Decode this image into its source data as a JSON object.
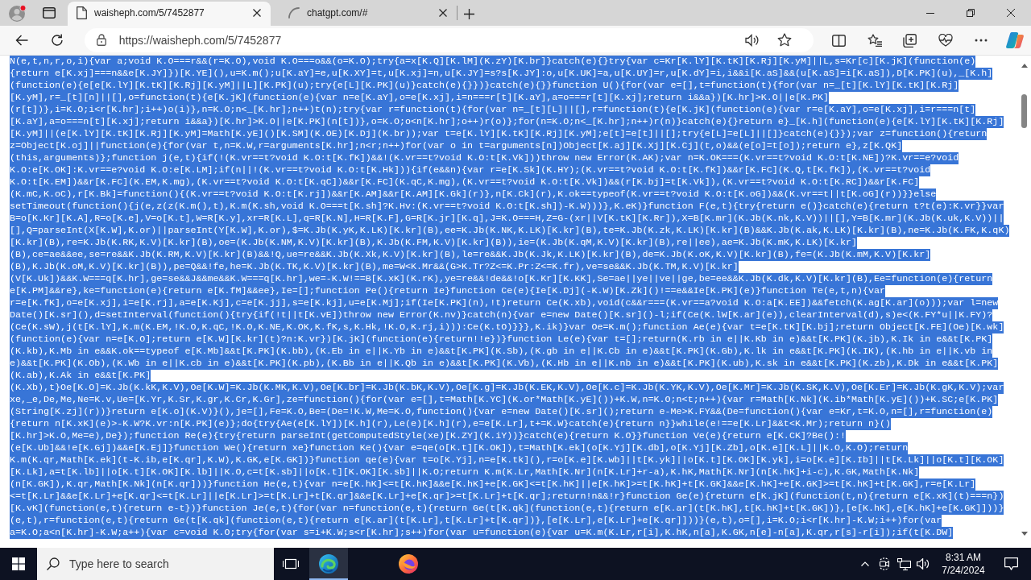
{
  "browser": {
    "tabs": [
      {
        "title": "waisheph.com/5/7452877",
        "selected": true,
        "kind": "page"
      },
      {
        "title": "chatgpt.com/#",
        "selected": false,
        "kind": "loading"
      }
    ],
    "address": {
      "value": "https://waisheph.com/5/7452877"
    }
  },
  "page": {
    "lines": [
      {
        "text": "N(e,t,n,r,o,i){var a;void K.O===r&&(r=K.O),void K.O===o&&(o=K.O);try{a=x[K.Q][K.lM](K.zY)[K.br]}catch(e){}try{var c=Kr[K.lY][K.tK][K.Rj][K.yM]||L,s=Kr[c][K.jK](function(e)",
        "selected": true
      },
      {
        "text": "{return e[K.xj]===n&&e[K.JY]})[K.YE](),u=K.m();u[K.aY]=e,u[K.XY]=t,u[K.xj]=n,u[K.JY]=s?s[K.JY]:o,u[K.UK]=a,u[K.UY]=r,u[K.dY]=i,i&&i[K.aS]&&(u[K.aS]=i[K.aS]),D[K.PK](u),_[K.h]",
        "selected": true
      },
      {
        "text": "(function(e){e[e[K.lY][K.tK][K.Rj][K.yM]||L][K.PK](u);try{e[L][K.PK](u)}catch(e){}})}catch(e){}}function U(){for(var e=[],t=function(t){for(var n=_[t][K.lY][K.tK][K.Rj]",
        "selected": true
      },
      {
        "text": "[K.yM],r=_[t][n]||[],o=function(t){e[K.jK](function(e){var n=e[K.aY],o=e[K.xj],i=n===r[t][K.aY],a=o===r[t][K.xj];return i&&a})[K.hr]>K.O||e[K.PK]",
        "selected": true
      },
      {
        "text": "(r[t])},i=K.O;i<r[K.hr];i++)o(i)},n=K.O;n<_[K.hr];n++)t(n);try{var r=function(t){for(var n=_[t][L]||[],r=function(t){e[K.jK](function(e){var r=e[K.aY],o=e[K.xj],i=r===n[t]",
        "selected": true
      },
      {
        "text": "[K.aY],a=o===n[t][K.xj];return i&&a})[K.hr]>K.O||e[K.PK](n[t])},o=K.O;o<n[K.hr];o++)r(o)};for(n=K.O;n<_[K.hr];n++)r(n)}catch(e){}return e}_[K.h](function(e){e[K.lY][K.tK][K.Rj]",
        "selected": true
      },
      {
        "text": "[K.yM]||(e[K.lY][K.tK][K.Rj][K.yM]=Math[K.yE]()[K.SM](K.OE)[K.Dj](K.br));var t=e[K.lY][K.tK][K.Rj][K.yM];e[t]=e[t]||[];try{e[L]=e[L]||[]}catch(e){}});var z=function(){return",
        "selected": true
      },
      {
        "text": "z=Object[K.oj]||function(e){for(var t,n=K.W,r=arguments[K.hr];n<r;n++)for(var o in t=arguments[n])Object[K.aj][K.Xj][K.Cj](t,o)&&(e[o]=t[o]);return e},z[K.QK]",
        "selected": true
      },
      {
        "text": "(this,arguments)};function j(e,t){if(!(K.vr==t?void K.O:t[K.fK])&&!(K.vr==t?void K.O:t[K.Vk]))throw new Error(K.AK);var n=K.OK===(K.vr==t?void K.O:t[K.NE])?K.vr==e?void",
        "selected": true
      },
      {
        "text": "K.O:e[K.OK]:K.vr==e?void K.O:e[K.LM];if(n||!(K.vr==t?void K.O:t[K.Hk])){if(e&&n){var r=e[K.Sk](K.HY);(K.vr==t?void K.O:t[K.fK])&&r[K.FC](K.Q,t[K.fK]),(K.vr==t?void",
        "selected": true
      },
      {
        "text": "K.O:t[K.EM])&&r[K.FC](K.EM,K.mg),(K.vr==t?void K.O:t[K.qC])&&r[K.FC](K.qC,K.mg),(K.vr==t?void K.O:t[K.Vk])&&(r[K.bj]=t[K.Vk]),(K.vr==t?void K.O:t[K.RC])&&r[K.FC]",
        "selected": true
      },
      {
        "text": "(K.mC,K.oC),r[K.Bk]=function(){(K.vr==t?void K.O:t[K.rj])&&r[K.AM]&&r[K.AM][K.Gk](r)},n[K.Ck](r),K.ok==typeof(K.vr==t?void K.O:t[K.oG])&&(K.vr==t||t[K.oG](r))}}else",
        "selected": true
      },
      {
        "text": "setTimeout(function(){j(e,z(z(K.m(),t),K.m(K.sh,void K.O===t[K.sh]?K.Hv:(K.vr==t?void K.O:t[K.sh])-K.W)))},K.eK)}function F(e,t){try{return e()}catch(e){return t?t(e):K.vr}}var",
        "selected": true
      },
      {
        "text": "B=o[K.Kr][K.A],R=o[K.e],V=o[K.t],W=R[K.y],xr=R[K.L],q=R[K.N],H=R[K.F],G=R[K.jr][K.q],J=K.O===H,Z=G-(xr||V[K.tK][K.Rr]),X=B[K.mr](K.Jb(K.nk,K.V))||[],Y=B[K.mr](K.Jb(K.uk,K.V))||",
        "selected": true
      },
      {
        "text": "[],Q=parseInt(X[K.W],K.or)||parseInt(Y[K.W],K.or),$=K.Jb(K.yK,K.LK)[K.kr](B),ee=K.Jb(K.NK,K.LK)[K.kr](B),te=K.Jb(K.zk,K.LK)[K.kr](B)&&K.Jb(K.ak,K.LK)[K.kr](B),ne=K.Jb(K.FK,K.qK)",
        "selected": true
      },
      {
        "text": "[K.kr](B),re=K.Jb(K.RK,K.V)[K.kr](B),oe=(K.Jb(K.NM,K.V)[K.kr](B),K.Jb(K.FM,K.V)[K.kr](B)),ie=(K.Jb(K.qM,K.V)[K.kr](B),re||ee),ae=K.Jb(K.mK,K.LK)[K.kr]",
        "selected": true
      },
      {
        "text": "(B),ce=ae&&ee,se=re&&K.Jb(K.RM,K.V)[K.kr](B)&&!Q,ue=re&&K.Jb(K.Xk,K.V)[K.kr](B),le=re&&K.Jb(K.Jk,K.LK)[K.kr](B),de=K.Jb(K.oK,K.V)[K.kr](B),fe=(K.Jb(K.mM,K.V)[K.kr]",
        "selected": true
      },
      {
        "text": "(B),K.Jb(K.oM,K.V)[K.kr](B)),pe=Q&&!fe,he=K.Jb(K.TK,K.V)[K.kr](B),me=W<K.Mr&&(G>K.Tr?Z<=K.Pr:Z<=K.fr),ve=se&&K.Jb(K.TM,K.V)[K.kr]",
        "selected": true
      },
      {
        "text": "(V[K.Uk])&&K.W===q[K.hr],ge=se&&J&&me&&K.W===q[K.hr],we=-K.W!==B[K.xK](K.rK),ye=re&&!de&&!o[K.Kr][K.KK],Se=ae||ye||ve||ge,be=ee&&K.Jb(K.dk,K.V)[K.kr](B),Ee=function(e){return",
        "selected": true
      },
      {
        "text": "e[K.PM]&&re},ke=function(e){return e[K.fM]&&ee},Ie=[];function Pe(){return Ie}function Ce(e){Ie[K.Dj](-K.W)[K.Zk]()!==e&&Ie[K.PK](e)}function Te(e,t,n){var",
        "selected": true
      },
      {
        "text": "r=e[K.fK],o=e[K.xj],i=e[K.rj],a=e[K.Kj],c=e[K.jj],s=e[K.kj],u=e[K.Mj];if(Ie[K.PK](n),!t)return Ce(K.xb),void(c&&r===(K.vr==a?void K.O:a[K.EE])&&fetch(K.ag[K.ar](o)));var l=new",
        "selected": true
      },
      {
        "text": "Date()[K.sr](),d=setInterval(function(){try{if(!t||t[K.vE])throw new Error(K.nv)}catch(n){var e=new Date()[K.sr]()-l;if(Ce(K.lW[K.ar](e)),clearInterval(d),s)e<(K.FY*u||K.FY)?",
        "selected": true
      },
      {
        "text": "(Ce(K.sW),j(t[K.lY],K.m(K.EM,!K.O,K.qC,!K.O,K.NE,K.OK,K.fK,s,K.Hk,!K.O,K.rj,i))):Ce(K.tO)}}},K.ik)}var Oe=K.m();function Ae(e){var t=e[K.tK][K.bj];return Object[K.FE](Oe)[K.wk]",
        "selected": true
      },
      {
        "text": "(function(e){var n=e[K.O];return e[K.W][K.kr](t)?n:K.vr})[K.jK](function(e){return!!e})}function Le(e){var t=[];return(K.rb in e||K.Kb in e)&&t[K.PK](K.jb),K.Ik in e&&t[K.PK]",
        "selected": true
      },
      {
        "text": "(K.kb),K.Mb in e&&K.ok==typeof e[K.Mb]&&t[K.PK](K.bb),(K.Eb in e||K.Yb in e)&&t[K.PK](K.Sb),(K.gb in e||K.Cb in e)&&t[K.PK](K.Gb),K.lk in e&&t[K.PK](K.IK),(K.hb in e||K.vb in",
        "selected": true
      },
      {
        "text": "e)&&t[K.PK](K.Ob),(K.Wb in e||K.cb in e)&&t[K.PK](K.pb),(K.Bb in e||K.Qb in e)&&t[K.PK](K.Vb),(K.Hb in e||K.nb in e)&&t[K.PK](K.ub),K.sk in e&&t[K.PK](K.zb),K.Dk in e&&t[K.PK]",
        "selected": true
      },
      {
        "text": "(K.ab),K.Ak in e&&t[K.PK]",
        "selected": true
      },
      {
        "text": "(K.Xb),t}Oe[K.O]=K.Jb(K.kK,K.V),Oe[K.W]=K.Jb(K.MK,K.V),Oe[K.br]=K.Jb(K.bK,K.V),Oe[K.g]=K.Jb(K.EK,K.V),Oe[K.c]=K.Jb(K.YK,K.V),Oe[K.Mr]=K.Jb(K.SK,K.V),Oe[K.Er]=K.Jb(K.gK,K.V);var",
        "selected": true
      },
      {
        "text": "xe,_e,De,Me,Ne=K.v,Ue=[K.Yr,K.Sr,K.gr,K.Cr,K.Gr],ze=function(){for(var e=[],t=Math[K.YC](K.or*Math[K.yE]())+K.W,n=K.O;n<t;n++){var r=Math[K.Nk](K.ib*Math[K.yE]())+K.SC;e[K.PK]",
        "selected": true
      },
      {
        "text": "(String[K.zj](r))}return e[K.o](K.V)}(),je=[],Fe=K.O,Be=(De=!K.W,Me=K.O,function(){var e=new Date()[K.sr]();return e-Me>K.FY&&(De=function(){var e=Kr,t=K.O,n=[],r=function(e)",
        "selected": true
      },
      {
        "text": "{return n[K.xK](e)>-K.W?K.vr:n[K.PK](e)};do{try{Ae(e[K.lY])[K.h](r),Le(e)[K.h](r),e=e[K.Lr],t+=K.W}catch(e){return n}}while(e!==e[K.Lr]&&t<K.Mr);return n}()",
        "selected": true
      },
      {
        "text": "[K.hr]>K.O,Me=e),De});function Re(e){try{return parseInt(getComputedStyle(xe)[K.ZY](K.iY))}catch(e){return K.O}}function Ve(e){return e[K.CK]?Be():!",
        "selected": true
      },
      {
        "text": "(e[K.Ub]&&!e[K.Gj])&&e[K.Ej]}function We(){return xe}function Ke(){var e=qe(o[K.t][K.OK]),t=Math[K.ek](o[K.Yj][K.db],o[K.Yj][K.Zb],o[K.e][K.L]||K.O,K.O);return",
        "selected": true
      },
      {
        "text": "K.m(K.qr,Math[K.ek](t-K.ib,e[K.qr],K.W),K.GK,e[K.GK])}function qe(e){var t=o[K.Yj],n=e[K.tk](),r=o[K.e][K.wb]||t[K.yk]||o[K.t][K.OK][K.yk],i=o[K.e][K.Ib]||t[K.Lk]||o[K.t][K.OK]",
        "selected": true
      },
      {
        "text": "[K.Lk],a=t[K.lb]||o[K.t][K.OK][K.lb]||K.O,c=t[K.sb]||o[K.t][K.OK][K.sb]||K.O;return K.m(K.Lr,Math[K.Nr](n[K.Lr]+r-a),K.hK,Math[K.Nr](n[K.hK]+i-c),K.GK,Math[K.Nk]",
        "selected": true
      },
      {
        "text": "(n[K.GK]),K.qr,Math[K.Nk](n[K.qr]))}function He(e,t){var n=e[K.hK]<=t[K.hK]&&e[K.hK]+e[K.GK]<=t[K.hK]||e[K.hK]>=t[K.hK]+t[K.GK]&&e[K.hK]+e[K.GK]>=t[K.hK]+t[K.GK],r=e[K.Lr]",
        "selected": true
      },
      {
        "text": "<=t[K.Lr]&&e[K.Lr]+e[K.qr]<=t[K.Lr]||e[K.Lr]>=t[K.Lr]+t[K.qr]&&e[K.Lr]+e[K.qr]>=t[K.Lr]+t[K.qr];return!n&&!r}function Ge(e){return e[K.jK](function(t,n){return e[K.xK](t)===n})",
        "selected": true
      },
      {
        "text": "[K.vK](function(e,t){return e-t})}function Je(e,t){for(var n=function(e,t){return Ge(t[K.qk](function(e,t){return e[K.ar](t[K.hK],t[K.hK]+t[K.GK])},[e[K.hK],e[K.hK]+e[K.GK]]))}",
        "selected": true
      },
      {
        "text": "(e,t),r=function(e,t){return Ge(t[K.qk](function(e,t){return e[K.ar](t[K.Lr],t[K.Lr]+t[K.qr])},[e[K.Lr],e[K.Lr]+e[K.qr]]))}(e,t),o=[],i=K.O;i<r[K.hr]-K.W;i++)for(var",
        "selected": true
      },
      {
        "text": "a=K.O;a<n[K.hr]-K.W;a++){var c=void K.O;try{for(var s=i+K.W;s<r[K.hr];s++)for(var u=function(e){var u=K.m(K.Lr,r[i],K.hK,n[a],K.GK,n[e]-n[a],K.qr,r[s]-r[i]);if(t[K.DW]",
        "selected": true
      }
    ]
  },
  "taskbar": {
    "search": {
      "placeholder": "Type here to search"
    },
    "apps": [
      {
        "kind": "swirl",
        "selected": true
      },
      {
        "kind": "flame",
        "selected": false
      }
    ],
    "clock": {
      "time": "8:31 AM",
      "date": "7/24/2024"
    }
  }
}
